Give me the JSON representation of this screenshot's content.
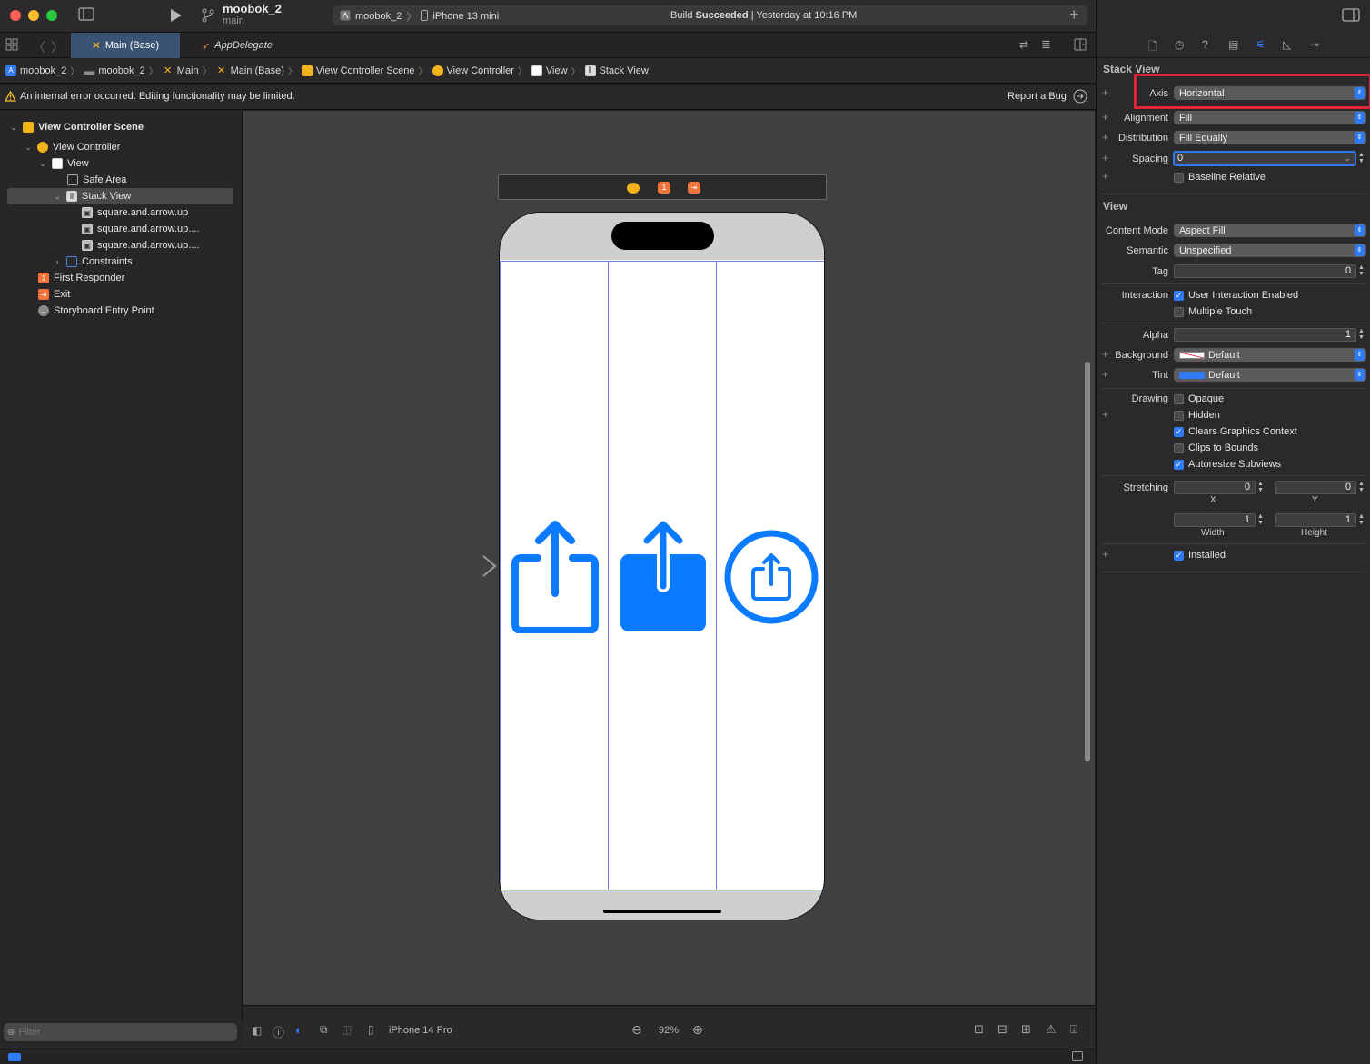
{
  "toolbar": {
    "project_name": "moobok_2",
    "branch": "main",
    "scheme": "moobok_2",
    "device": "iPhone 13 mini",
    "status_prefix": "Build",
    "status_result": "Succeeded",
    "status_time": "| Yesterday at 10:16 PM"
  },
  "tabs": [
    {
      "label": "Main (Base)",
      "active": true
    },
    {
      "label": "AppDelegate",
      "active": false
    }
  ],
  "breadcrumbs": [
    "moobok_2",
    "moobok_2",
    "Main",
    "Main (Base)",
    "View Controller Scene",
    "View Controller",
    "View",
    "Stack View"
  ],
  "warning": {
    "message": "An internal error occurred. Editing functionality may be limited.",
    "action": "Report a Bug"
  },
  "outline": [
    {
      "label": "View Controller Scene",
      "bold": true
    },
    {
      "label": "View Controller"
    },
    {
      "label": "View"
    },
    {
      "label": "Safe Area"
    },
    {
      "label": "Stack View"
    },
    {
      "label": "square.and.arrow.up"
    },
    {
      "label": "square.and.arrow.up...."
    },
    {
      "label": "square.and.arrow.up...."
    },
    {
      "label": "Constraints"
    },
    {
      "label": "First Responder"
    },
    {
      "label": "Exit"
    },
    {
      "label": "Storyboard Entry Point"
    }
  ],
  "scene_dock_badge": "1",
  "filter": {
    "placeholder": "Filter"
  },
  "canvas_bottom": {
    "device": "iPhone 14 Pro",
    "zoom": "92%"
  },
  "inspector": {
    "stack_view_title": "Stack View",
    "axis": {
      "label": "Axis",
      "value": "Horizontal"
    },
    "alignment": {
      "label": "Alignment",
      "value": "Fill"
    },
    "distribution": {
      "label": "Distribution",
      "value": "Fill Equally"
    },
    "spacing": {
      "label": "Spacing",
      "value": "0"
    },
    "baseline_relative": {
      "label": "Baseline Relative",
      "checked": false
    },
    "view_title": "View",
    "content_mode": {
      "label": "Content Mode",
      "value": "Aspect Fill"
    },
    "semantic": {
      "label": "Semantic",
      "value": "Unspecified"
    },
    "tag": {
      "label": "Tag",
      "value": "0"
    },
    "interaction_label": "Interaction",
    "user_interaction": {
      "label": "User Interaction Enabled",
      "checked": true
    },
    "multiple_touch": {
      "label": "Multiple Touch",
      "checked": false
    },
    "alpha": {
      "label": "Alpha",
      "value": "1"
    },
    "background": {
      "label": "Background",
      "value": "Default"
    },
    "tint": {
      "label": "Tint",
      "value": "Default"
    },
    "drawing_label": "Drawing",
    "opaque": {
      "label": "Opaque",
      "checked": false
    },
    "hidden": {
      "label": "Hidden",
      "checked": false
    },
    "clears_graphics": {
      "label": "Clears Graphics Context",
      "checked": true
    },
    "clips_to_bounds": {
      "label": "Clips to Bounds",
      "checked": false
    },
    "autoresize": {
      "label": "Autoresize Subviews",
      "checked": true
    },
    "stretching_label": "Stretching",
    "stretch_x": {
      "value": "0",
      "caption": "X"
    },
    "stretch_y": {
      "value": "0",
      "caption": "Y"
    },
    "stretch_w": {
      "value": "1",
      "caption": "Width"
    },
    "stretch_h": {
      "value": "1",
      "caption": "Height"
    },
    "installed": {
      "label": "Installed",
      "checked": true
    }
  },
  "colors": {
    "accent": "#2f7bf5",
    "highlight_box": "#e0243a",
    "symbol_blue": "#0a7aff"
  }
}
